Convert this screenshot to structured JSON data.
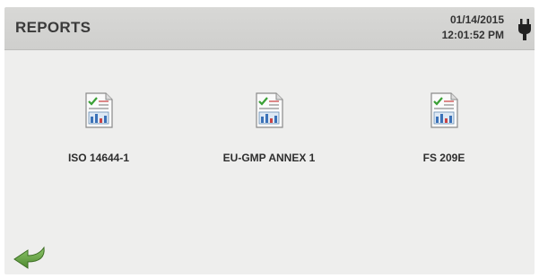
{
  "header": {
    "title": "REPORTS",
    "date": "01/14/2015",
    "time": "12:01:52 PM",
    "power_icon": "plug-icon"
  },
  "reports": [
    {
      "label": "ISO 14644-1",
      "icon": "report-document-icon"
    },
    {
      "label": "EU-GMP ANNEX 1",
      "icon": "report-document-icon"
    },
    {
      "label": "FS 209E",
      "icon": "report-document-icon"
    }
  ],
  "navigation": {
    "back_icon": "back-arrow-icon"
  },
  "colors": {
    "header_bg": "#d5d5d3",
    "screen_bg": "#eeeeed",
    "check": "#3aa035",
    "back_arrow": "#5f9a3c"
  }
}
